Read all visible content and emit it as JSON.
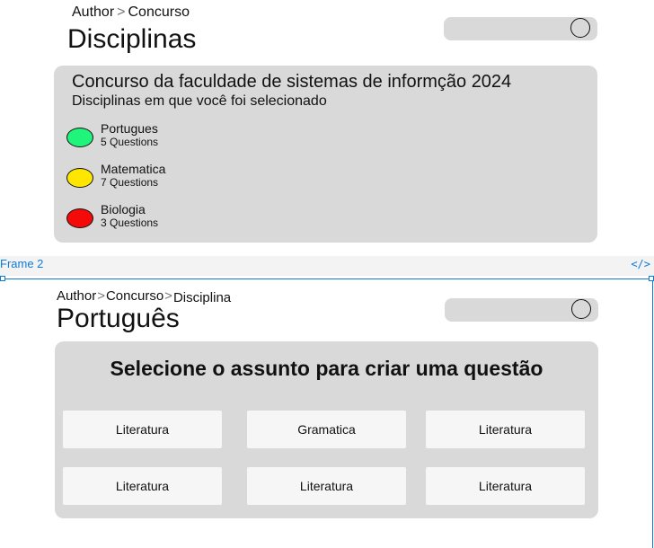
{
  "frame1": {
    "breadcrumb": [
      "Author",
      "Concurso"
    ],
    "breadcrumb_separator": ">",
    "title": "Disciplinas",
    "card": {
      "title": "Concurso da faculdade de sistemas de informção 2024",
      "subtitle": "Disciplinas em que você foi selecionado",
      "disciplines": [
        {
          "name": "Portugues",
          "questions": "5 Questions",
          "color": "#1ef57a"
        },
        {
          "name": "Matematica",
          "questions": "7 Questions",
          "color": "#ffe600"
        },
        {
          "name": "Biologia",
          "questions": "3 Questions",
          "color": "#f50a0a"
        }
      ]
    }
  },
  "frame_label": "Frame 2",
  "code_icon": "</>",
  "frame2": {
    "breadcrumb": [
      "Author",
      "Concurso",
      "Disciplina"
    ],
    "breadcrumb_separator": ">",
    "title": "Português",
    "card": {
      "title": "Selecione o assunto para criar uma questão",
      "topics": [
        "Literatura",
        "Gramatica",
        "Literatura",
        "Literatura",
        "Literatura",
        "Literatura"
      ]
    }
  },
  "colors": {
    "card_background": "#d9d9d9",
    "button_background": "#f6f6f6",
    "frame_accent": "#0d7bd9"
  }
}
